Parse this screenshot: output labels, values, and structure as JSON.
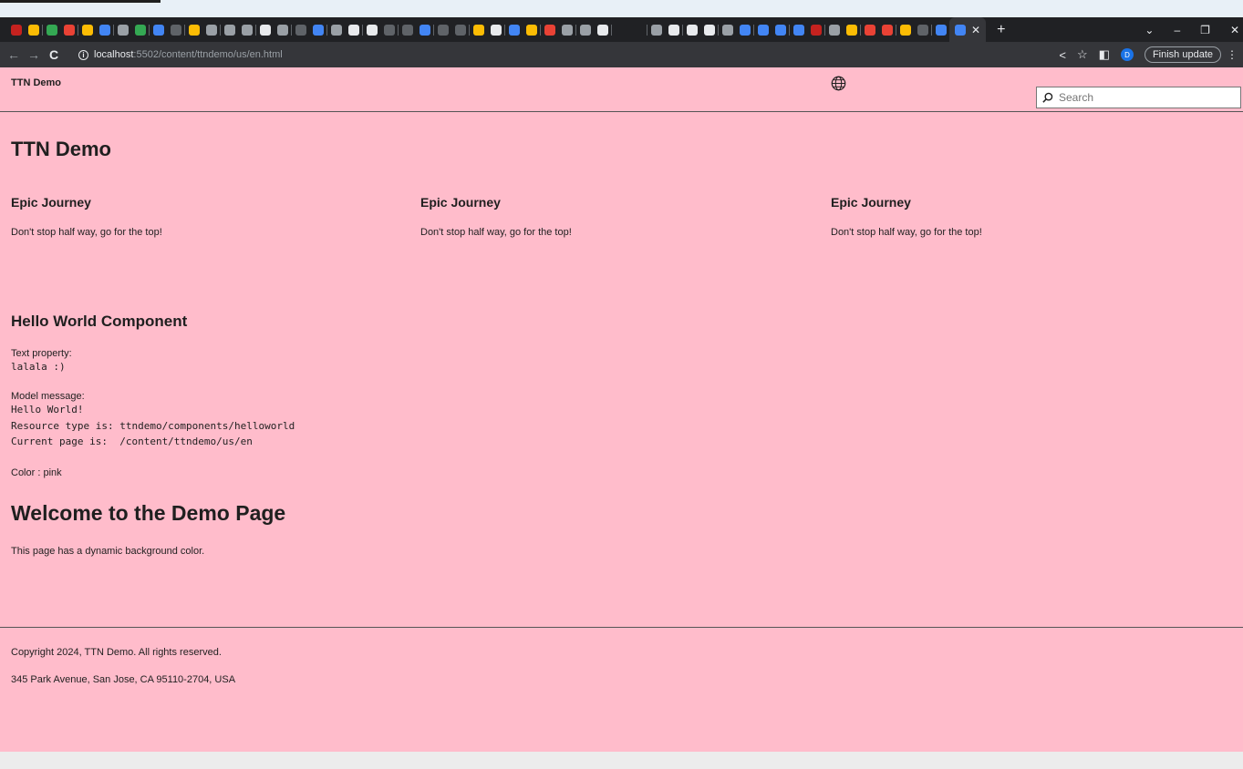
{
  "browser": {
    "favicon_colors": [
      "#c5221f",
      "#fbbc04",
      "#34a853",
      "#e94235",
      "#fbbc04",
      "#4285f4",
      "#9aa0a6",
      "#34a853",
      "#4285f4",
      "#5f6368",
      "#fbbc04",
      "#9aa0a6",
      "#9aa0a6",
      "#9aa0a6",
      "#e8eaed",
      "#9aa0a6",
      "#5f6368",
      "#4285f4",
      "#9aa0a6",
      "#e8eaed",
      "#e8eaed",
      "#5f6368",
      "#5f6368",
      "#4285f4",
      "#5f6368",
      "#5f6368",
      "#fbbc04",
      "#e8eaed",
      "#4285f4",
      "#fbbc04",
      "#e94235",
      "#9aa0a6",
      "#9aa0a6",
      "#e8eaed",
      "#202124",
      "#202124",
      "#9aa0a6",
      "#e8eaed",
      "#e8eaed",
      "#e8eaed",
      "#9aa0a6",
      "#4285f4",
      "#4285f4",
      "#4285f4",
      "#4285f4",
      "#c5221f",
      "#9aa0a6",
      "#fbbc04",
      "#e94235",
      "#e94235",
      "#fbbc04",
      "#5f6368",
      "#4285f4"
    ],
    "url_host": "localhost",
    "url_path": ":5502/content/ttndemo/us/en.html",
    "profile_initial": "D",
    "finish_update_label": "Finish update"
  },
  "header": {
    "brand": "TTN Demo",
    "search_placeholder": "Search"
  },
  "main": {
    "title": "TTN Demo",
    "teasers": [
      {
        "title": "Epic Journey",
        "text": "Don't stop half way, go for the top!"
      },
      {
        "title": "Epic Journey",
        "text": "Don't stop half way, go for the top!"
      },
      {
        "title": "Epic Journey",
        "text": "Don't stop half way, go for the top!"
      }
    ],
    "hello_world": {
      "title": "Hello World Component",
      "text_property_label": "Text property:",
      "text_property_value": "lalala :)",
      "model_message_label": "Model message:",
      "model_line1": "Hello World!",
      "model_line2": "Resource type is: ttndemo/components/helloworld",
      "model_line3": "Current page is:  /content/ttndemo/us/en",
      "color_line": "Color : pink"
    },
    "welcome_title": "Welcome to the Demo Page",
    "welcome_text": "This page has a dynamic background color."
  },
  "footer": {
    "copyright": "Copyright 2024, TTN Demo. All rights reserved.",
    "address": "345 Park Avenue, San Jose, CA 95110-2704, USA"
  },
  "colors": {
    "page_background": "#ffbccb"
  }
}
